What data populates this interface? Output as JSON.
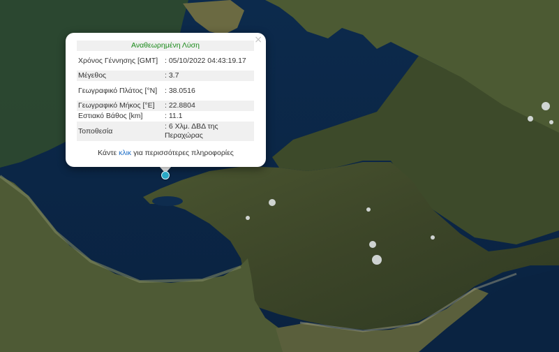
{
  "popup": {
    "title": "Αναθεωρημένη Λύση",
    "rows": [
      {
        "label": "Χρόνος Γέννησης [GMT]",
        "value": ": 05/10/2022 04:43:19.17"
      },
      {
        "label": "Μέγεθος",
        "value": ": 3.7"
      },
      {
        "label": "Γεωγραφικό Πλάτος [°N]",
        "value": ": 38.0516"
      },
      {
        "label": "Γεωγραφικό Μήκος [°E]",
        "value": ": 22.8804"
      },
      {
        "label": "Εστιακό Βάθος [km]",
        "value": ": 11.1"
      },
      {
        "label": "Τοποθεσία",
        "value": ": 6 Χλμ. ΔΒΔ της Περαχώρας"
      }
    ],
    "more_prefix": "Κάντε ",
    "more_link": "κλικ",
    "more_suffix": " για περισσότερες πληροφορίες",
    "close_glyph": "×"
  },
  "colors": {
    "sea": "#0b2748",
    "land": "#3f4a2a",
    "marker": "#29a8c6",
    "title_green": "#1a8a1a",
    "link_blue": "#1b6dc7"
  },
  "marker_icon": "epicenter-marker"
}
